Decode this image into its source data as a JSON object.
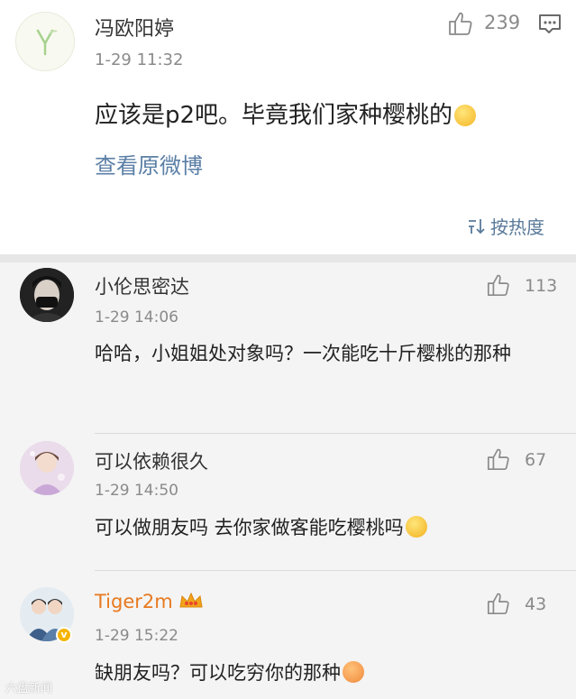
{
  "post": {
    "author": "冯欧阳婷",
    "time": "1-29 11:32",
    "like_count": "239",
    "text": "应该是p2吧。毕竟我们家种樱桃的",
    "view_original": "查看原微博",
    "sort_label": "按热度"
  },
  "comments": [
    {
      "name": "小伦思密达",
      "time": "1-29 14:06",
      "like_count": "113",
      "text": "哈哈，小姐姐处对象吗？一次能吃十斤樱桃的那种"
    },
    {
      "name": "可以依赖很久",
      "time": "1-29 14:50",
      "like_count": "67",
      "text": "可以做朋友吗 去你家做客能吃樱桃吗"
    },
    {
      "name": "Tiger2m",
      "time": "1-29 15:22",
      "like_count": "43",
      "text": "缺朋友吗？可以吃穷你的那种",
      "name_color": "#e8791e"
    }
  ],
  "watermark": "六盘新闻",
  "icons": {
    "like": "thumbs-up-icon",
    "reply": "comment-icon",
    "sort": "sort-icon",
    "verified": "verified-badge-icon",
    "vip": "crown-icon"
  }
}
